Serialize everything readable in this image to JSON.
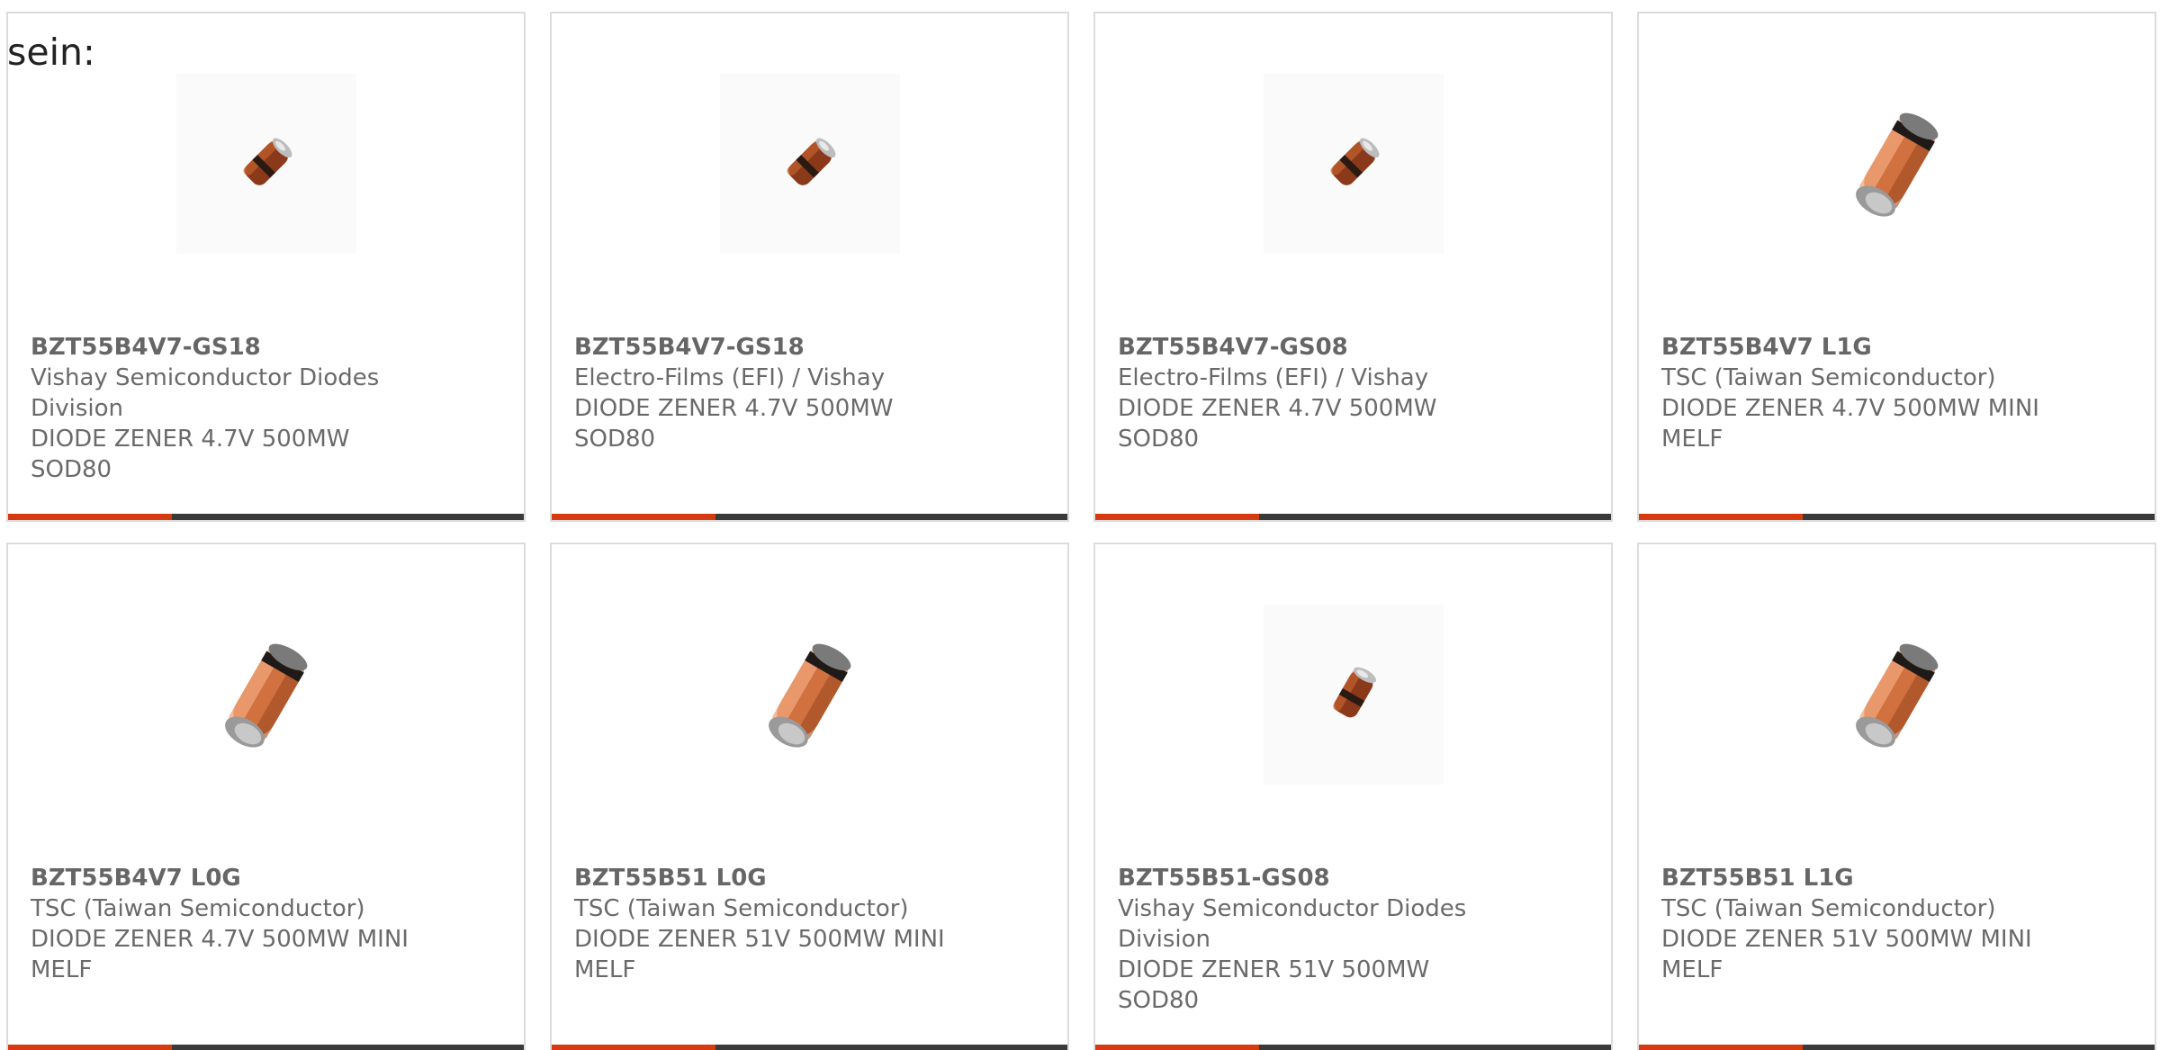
{
  "intro_text": "sein:",
  "colors": {
    "accent": "#d63a10",
    "bar": "#3a3a3a",
    "border": "#dcdcdc",
    "text": "#6a6a6a"
  },
  "products": [
    {
      "part_number": "BZT55B4V7-GS18",
      "manufacturer": "Vishay Semiconductor Diodes Division",
      "description": "DIODE ZENER 4.7V 500MW SOD80",
      "image": "sod80-diode-icon"
    },
    {
      "part_number": "BZT55B4V7-GS18",
      "manufacturer": "Electro-Films (EFI) / Vishay",
      "description": "DIODE ZENER 4.7V 500MW SOD80",
      "image": "sod80-diode-icon"
    },
    {
      "part_number": "BZT55B4V7-GS08",
      "manufacturer": "Electro-Films (EFI) / Vishay",
      "description": "DIODE ZENER 4.7V 500MW SOD80",
      "image": "sod80-diode-icon"
    },
    {
      "part_number": "BZT55B4V7 L1G",
      "manufacturer": "TSC (Taiwan Semiconductor)",
      "description": "DIODE ZENER 4.7V 500MW MINI MELF",
      "image": "mini-melf-diode-icon"
    },
    {
      "part_number": "BZT55B4V7 L0G",
      "manufacturer": "TSC (Taiwan Semiconductor)",
      "description": "DIODE ZENER 4.7V 500MW MINI MELF",
      "image": "mini-melf-diode-icon"
    },
    {
      "part_number": "BZT55B51 L0G",
      "manufacturer": "TSC (Taiwan Semiconductor)",
      "description": "DIODE ZENER 51V 500MW MINI MELF",
      "image": "mini-melf-diode-icon"
    },
    {
      "part_number": "BZT55B51-GS08",
      "manufacturer": "Vishay Semiconductor Diodes Division",
      "description": "DIODE ZENER 51V 500MW SOD80",
      "image": "sod80-diode-icon"
    },
    {
      "part_number": "BZT55B51 L1G",
      "manufacturer": "TSC (Taiwan Semiconductor)",
      "description": "DIODE ZENER 51V 500MW MINI MELF",
      "image": "mini-melf-diode-icon"
    }
  ]
}
